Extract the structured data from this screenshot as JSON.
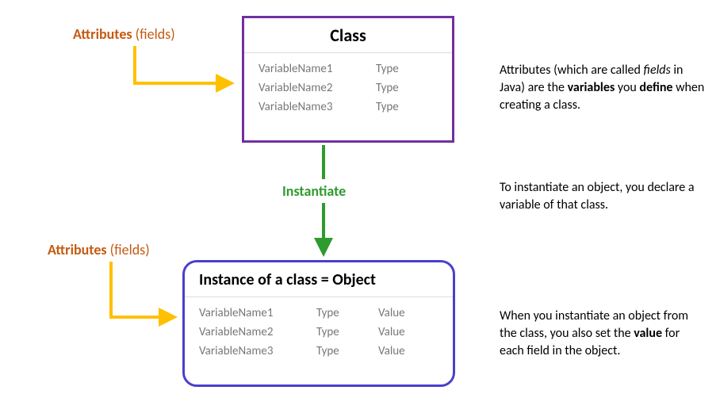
{
  "labels": {
    "attributes_top": "Attributes ",
    "attributes_bottom": "Attributes ",
    "fields_paren": "(fields)",
    "instantiate": "Instantiate"
  },
  "class_box": {
    "title": "Class",
    "rows": [
      {
        "name": "VariableName1",
        "type": "Type"
      },
      {
        "name": "VariableName2",
        "type": "Type"
      },
      {
        "name": "VariableName3",
        "type": "Type"
      }
    ]
  },
  "object_box": {
    "title_prefix": "Instance of a class ",
    "title_eq": "= ",
    "title_object": "Object",
    "rows": [
      {
        "name": "VariableName1",
        "type": "Type",
        "value": "Value"
      },
      {
        "name": "VariableName2",
        "type": "Type",
        "value": "Value"
      },
      {
        "name": "VariableName3",
        "type": "Type",
        "value": "Value"
      }
    ]
  },
  "explanations": {
    "top": {
      "pre": "Attributes (which are called ",
      "fields": "fields",
      "mid": " in Java) are the ",
      "variables": "variables",
      "mid2": " you ",
      "define": "define",
      "post": " when creating a class."
    },
    "middle": "To instantiate an object, you declare a variable of that class.",
    "bottom": {
      "pre": "When you instantiate an object from the class, you also set the ",
      "value": "value",
      "post": " for each field in the object."
    }
  },
  "colors": {
    "orange": "#C55A11",
    "yellow_arrow": "#FFC000",
    "purple": "#7030A0",
    "blue": "#4A3FCF",
    "green": "#2E9B2E"
  }
}
